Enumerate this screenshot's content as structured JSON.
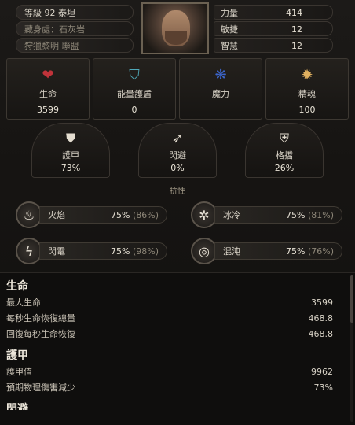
{
  "header": {
    "level_label": "等級 92 泰坦",
    "stash_label": "藏身處：石灰岩",
    "hunt_label": "狩獵黎明 聯盟",
    "stats": [
      {
        "label": "力量",
        "value": "414"
      },
      {
        "label": "敏捷",
        "value": "12"
      },
      {
        "label": "智慧",
        "value": "12"
      }
    ]
  },
  "big_stats": [
    {
      "icon": "heart-icon",
      "label": "生命",
      "value": "3599",
      "color": "#c0333a"
    },
    {
      "icon": "energy-shield-icon",
      "label": "能量護盾",
      "value": "0",
      "color": "#4fa8b8"
    },
    {
      "icon": "mana-icon",
      "label": "魔力",
      "value": "",
      "color": "#3b64c8"
    },
    {
      "icon": "spirit-icon",
      "label": "精魂",
      "value": "100",
      "color": "#e0b060"
    }
  ],
  "defense": [
    {
      "icon": "armour-icon",
      "label": "護甲",
      "value": "73%"
    },
    {
      "icon": "evasion-icon",
      "label": "閃避",
      "value": "0%"
    },
    {
      "icon": "block-icon",
      "label": "格擋",
      "value": "26%"
    }
  ],
  "resist_title": "抗性",
  "resists": [
    {
      "icon": "fire-icon",
      "label": "火焰",
      "value": "75%",
      "max": "(86%)"
    },
    {
      "icon": "cold-icon",
      "label": "冰冷",
      "value": "75%",
      "max": "(81%)"
    },
    {
      "icon": "lightning-icon",
      "label": "閃電",
      "value": "75%",
      "max": "(98%)"
    },
    {
      "icon": "chaos-icon",
      "label": "混沌",
      "value": "75%",
      "max": "(76%)"
    }
  ],
  "sections": [
    {
      "title": "生命",
      "rows": [
        {
          "label": "最大生命",
          "value": "3599"
        },
        {
          "label": "每秒生命恢復總量",
          "value": "468.8"
        },
        {
          "label": "回復每秒生命恢復",
          "value": "468.8"
        }
      ]
    },
    {
      "title": "護甲",
      "rows": [
        {
          "label": "護甲值",
          "value": "9962"
        },
        {
          "label": "預期物理傷害減少",
          "value": "73%"
        }
      ]
    }
  ],
  "cut_section": "閃避"
}
